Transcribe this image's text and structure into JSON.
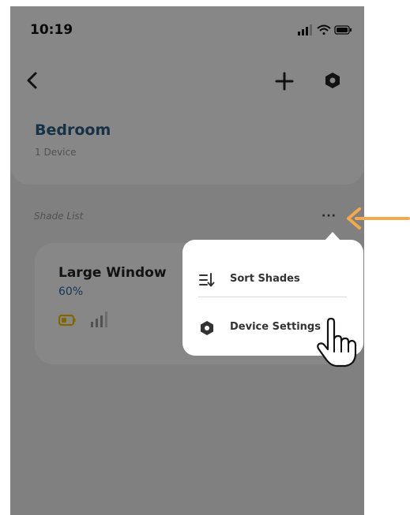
{
  "status_bar": {
    "time": "10:19"
  },
  "header": {
    "back_icon": "chevron-left-icon",
    "add_icon": "plus-icon",
    "settings_icon": "hexagon-icon"
  },
  "room": {
    "name": "Bedroom",
    "device_count": "1 Device"
  },
  "shade_list": {
    "label": "Shade List",
    "more_label": "···",
    "items": [
      {
        "name": "Large Window",
        "position": "60%",
        "battery_color": "#f2c400"
      }
    ]
  },
  "menu": {
    "items": [
      {
        "label": "Sort Shades",
        "icon": "sort-icon"
      },
      {
        "label": "Device Settings",
        "icon": "hexagon-icon"
      }
    ]
  },
  "colors": {
    "accent_blue": "#2c5d82",
    "arrow_orange": "#f5a94a"
  }
}
